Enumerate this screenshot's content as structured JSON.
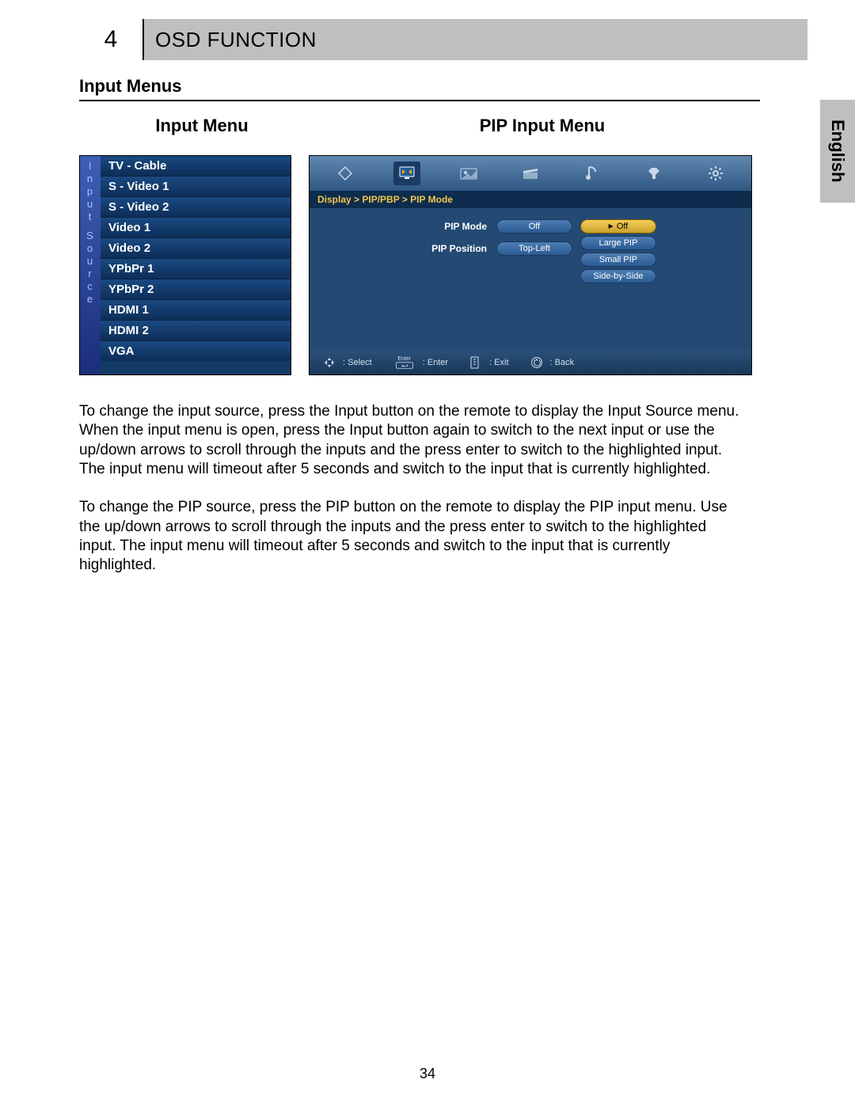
{
  "header": {
    "chapter_number": "4",
    "title": "OSD FUNCTION"
  },
  "language_tab": "English",
  "section_title": "Input Menus",
  "menu_headings": {
    "left": "Input Menu",
    "right": "PIP Input Menu"
  },
  "input_source": {
    "rail_label": "Input Source",
    "items": [
      "TV - Cable",
      "S - Video 1",
      "S - Video 2",
      "Video 1",
      "Video 2",
      "YPbPr 1",
      "YPbPr 2",
      "HDMI 1",
      "HDMI 2",
      "VGA"
    ]
  },
  "pip_menu": {
    "breadcrumb": "Display > PIP/PBP > PIP Mode",
    "rows": [
      {
        "label": "PIP Mode",
        "value": "Off"
      },
      {
        "label": "PIP Position",
        "value": "Top-Left"
      }
    ],
    "options": [
      "Off",
      "Large PIP",
      "Small PIP",
      "Side-by-Side"
    ],
    "footer": {
      "select": ": Select",
      "enter_small": "Enter",
      "enter": ": Enter",
      "exit": ": Exit",
      "back": ": Back"
    }
  },
  "paragraphs": {
    "p1": "To change the input source, press the Input button on the remote to display the Input Source menu. When the input menu is open, press the Input button again to switch to the next input or use the up/down arrows to scroll through the inputs and the press enter to switch to the highlighted input. The input menu will timeout after 5 seconds and switch to the input that is currently highlighted.",
    "p2": "To change the PIP source, press the PIP button on the remote to display the PIP input menu. Use the up/down arrows to scroll through the inputs and the press enter to switch to the highlighted input. The input menu will timeout after 5 seconds and switch to the input that is currently highlighted."
  },
  "page_number": "34"
}
